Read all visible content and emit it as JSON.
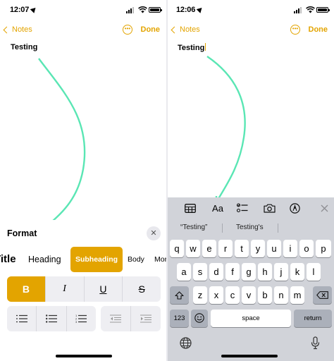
{
  "left": {
    "status": {
      "time": "12:07"
    },
    "nav": {
      "back_label": "Notes",
      "done_label": "Done"
    },
    "note": {
      "text": "Testing"
    },
    "format": {
      "title": "Format",
      "styles": [
        "Title",
        "Heading",
        "Subheading",
        "Body",
        "Mor"
      ],
      "selected_style": "Subheading",
      "buttons": {
        "bold": "B",
        "italic": "I",
        "underline": "U",
        "strike": "S"
      }
    }
  },
  "right": {
    "status": {
      "time": "12:06"
    },
    "nav": {
      "back_label": "Notes",
      "done_label": "Done"
    },
    "note": {
      "text": "Testing"
    },
    "toolbar": {
      "format_label": "Aa"
    },
    "predictions": [
      "“Testing”",
      "Testing's"
    ],
    "keyboard": {
      "row1": [
        "q",
        "w",
        "e",
        "r",
        "t",
        "y",
        "u",
        "i",
        "o",
        "p"
      ],
      "row2": [
        "a",
        "s",
        "d",
        "f",
        "g",
        "h",
        "j",
        "k",
        "l"
      ],
      "row3": [
        "z",
        "x",
        "c",
        "v",
        "b",
        "n",
        "m"
      ],
      "numbers_label": "123",
      "space_label": "space",
      "return_label": "return"
    }
  },
  "colors": {
    "accent": "#e3a400",
    "arrow": "#5ae6b4",
    "keyboard_bg": "#d1d3d9",
    "special_key": "#abb0ba"
  }
}
